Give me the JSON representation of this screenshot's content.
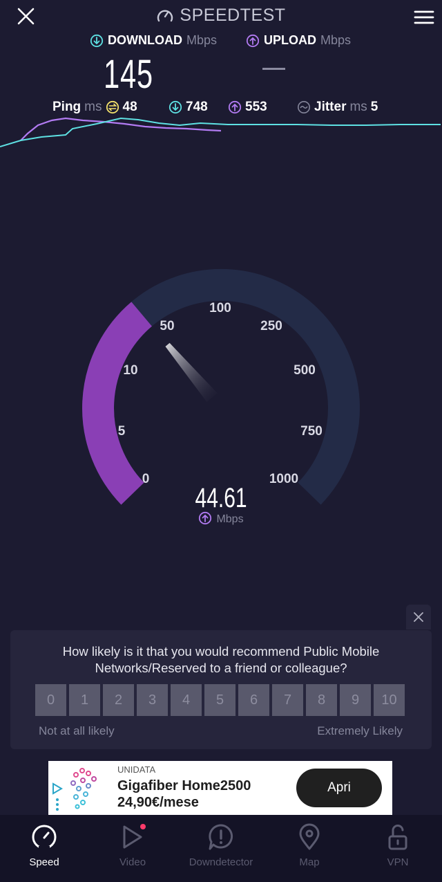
{
  "header": {
    "brand": "SPEEDTEST"
  },
  "download": {
    "label": "DOWNLOAD",
    "unit": "Mbps",
    "value": "145"
  },
  "upload": {
    "label": "UPLOAD",
    "unit": "Mbps",
    "value": "—"
  },
  "ping": {
    "label": "Ping",
    "unit": "ms",
    "idle": "48",
    "download": "748",
    "upload": "553"
  },
  "jitter": {
    "label": "Jitter",
    "unit": "ms",
    "value": "5"
  },
  "gauge": {
    "ticks": [
      "0",
      "5",
      "10",
      "50",
      "100",
      "250",
      "500",
      "750",
      "1000"
    ],
    "value": "44.61",
    "unit": "Mbps",
    "fill_fraction": 0.35
  },
  "survey": {
    "question": "How likely is it that you would recommend Public Mobile Networks/Reserved to a friend or colleague?",
    "options": [
      "0",
      "1",
      "2",
      "3",
      "4",
      "5",
      "6",
      "7",
      "8",
      "9",
      "10"
    ],
    "low_label": "Not at all likely",
    "high_label": "Extremely Likely"
  },
  "ad": {
    "brand": "UNIDATA",
    "title": "Gigafiber Home2500",
    "price": "24,90€/mese",
    "cta": "Apri"
  },
  "nav": [
    {
      "label": "Speed",
      "icon": "speedometer-icon",
      "active": true
    },
    {
      "label": "Video",
      "icon": "play-icon",
      "active": false
    },
    {
      "label": "Downdetector",
      "icon": "alert-icon",
      "active": false
    },
    {
      "label": "Map",
      "icon": "map-pin-icon",
      "active": false
    },
    {
      "label": "VPN",
      "icon": "lock-icon",
      "active": false
    }
  ],
  "colors": {
    "background": "#1c1b31",
    "download": "#5ee1e3",
    "upload": "#b27bf2",
    "gauge_fill": "#8a3fb5",
    "gauge_track": "#232b47"
  }
}
